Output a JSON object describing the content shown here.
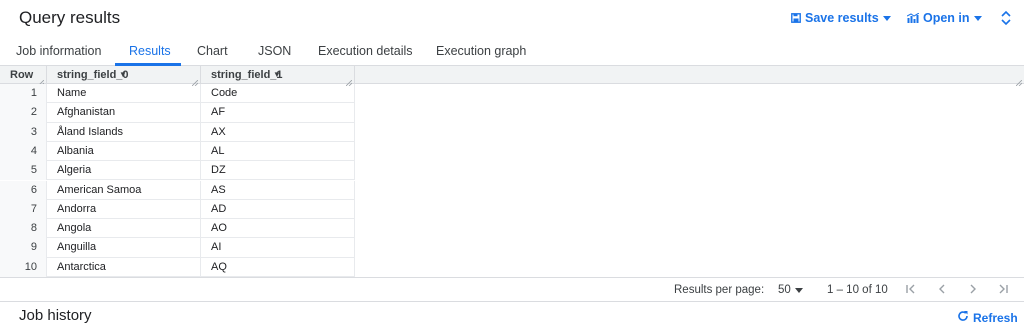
{
  "header": {
    "title": "Query results",
    "save_results": "Save results",
    "open_in": "Open in"
  },
  "tabs": [
    {
      "label": "Job information",
      "active": false
    },
    {
      "label": "Results",
      "active": true
    },
    {
      "label": "Chart",
      "active": false
    },
    {
      "label": "JSON",
      "active": false
    },
    {
      "label": "Execution details",
      "active": false
    },
    {
      "label": "Execution graph",
      "active": false
    }
  ],
  "table": {
    "columns": [
      "Row",
      "string_field_0",
      "string_field_1"
    ],
    "rows": [
      [
        "1",
        "Name",
        "Code"
      ],
      [
        "2",
        "Afghanistan",
        "AF"
      ],
      [
        "3",
        "Åland Islands",
        "AX"
      ],
      [
        "4",
        "Albania",
        "AL"
      ],
      [
        "5",
        "Algeria",
        "DZ"
      ],
      [
        "6",
        "American Samoa",
        "AS"
      ],
      [
        "7",
        "Andorra",
        "AD"
      ],
      [
        "8",
        "Angola",
        "AO"
      ],
      [
        "9",
        "Anguilla",
        "AI"
      ],
      [
        "10",
        "Antarctica",
        "AQ"
      ]
    ]
  },
  "pagination": {
    "results_per_page_label": "Results per page:",
    "results_per_page": "50",
    "range": "1 – 10 of 10"
  },
  "job_history": {
    "title": "Job history",
    "refresh": "Refresh"
  },
  "colors": {
    "accent": "#1a73e8",
    "text": "#202124",
    "border": "#dadce0"
  }
}
